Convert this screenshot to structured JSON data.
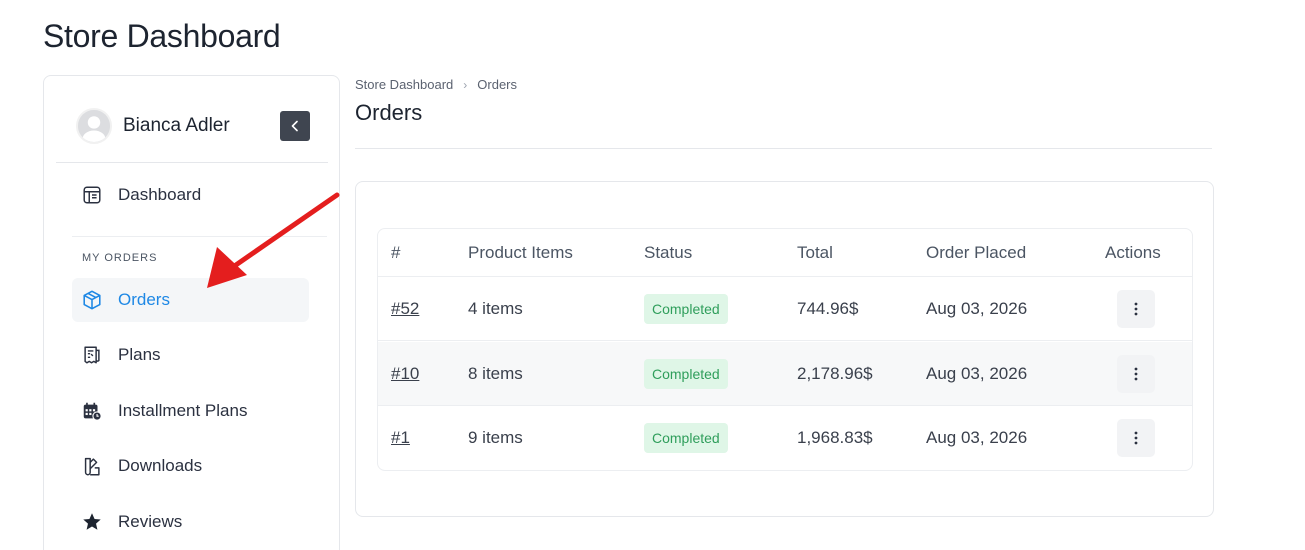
{
  "page": {
    "title": "Store Dashboard"
  },
  "sidebar": {
    "user_name": "Bianca Adler",
    "section_label": "MY ORDERS",
    "items": [
      {
        "label": "Dashboard",
        "icon": "dashboard-icon"
      },
      {
        "label": "Orders",
        "icon": "box-icon",
        "active": true
      },
      {
        "label": "Plans",
        "icon": "receipt-icon"
      },
      {
        "label": "Installment Plans",
        "icon": "calendar-icon"
      },
      {
        "label": "Downloads",
        "icon": "downloads-icon"
      },
      {
        "label": "Reviews",
        "icon": "star-icon"
      }
    ]
  },
  "breadcrumb": {
    "root": "Store Dashboard",
    "current": "Orders"
  },
  "main": {
    "title": "Orders"
  },
  "table": {
    "headers": [
      "#",
      "Product Items",
      "Status",
      "Total",
      "Order Placed",
      "Actions"
    ],
    "rows": [
      {
        "id": "#52",
        "items": "4 items",
        "status": "Completed",
        "total": "744.96$",
        "placed": "Aug 03, 2026"
      },
      {
        "id": "#10",
        "items": "8 items",
        "status": "Completed",
        "total": "2,178.96$",
        "placed": "Aug 03, 2026"
      },
      {
        "id": "#1",
        "items": "9 items",
        "status": "Completed",
        "total": "1,968.83$",
        "placed": "Aug 03, 2026"
      }
    ]
  },
  "colors": {
    "accent": "#1e88e5",
    "badge_bg": "#dff6e7",
    "badge_text": "#2f9e5b",
    "annotation_arrow": "#e41e1e"
  }
}
